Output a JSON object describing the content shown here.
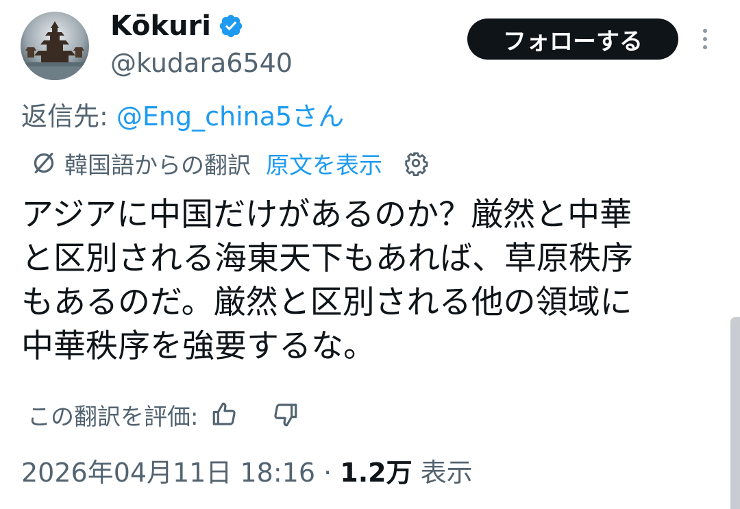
{
  "author": {
    "display_name": "Kōkuri",
    "handle": "@kudara6540",
    "verified": true,
    "avatar_icon": "avatar-pagoda-image"
  },
  "follow_button": {
    "label": "フォローする"
  },
  "more_icon": "more-vertical-icon",
  "reply": {
    "prefix": "返信先: ",
    "mention": "@Eng_china5さん"
  },
  "translation": {
    "icon": "translate-icon",
    "label": "韓国語からの翻訳",
    "show_original": "原文を表示",
    "settings_icon": "gear-icon"
  },
  "tweet": {
    "text": "アジアに中国だけがあるのか？厳然と中華\nと区別される海東天下もあれば、草原秩序\nもあるのだ。厳然と区別される他の領域に\n中華秩序を強要するな。"
  },
  "rating": {
    "label": "この翻訳を評価: ",
    "thumbs_up_icon": "thumbs-up-icon",
    "thumbs_down_icon": "thumbs-down-icon"
  },
  "meta": {
    "timestamp": "2026年04月11日 18:16",
    "separator": " · ",
    "views_count": "1.2万",
    "views_label": " 表示"
  },
  "colors": {
    "text_primary": "#0f1419",
    "text_secondary": "#536471",
    "link_blue": "#1d9bf0",
    "verified_blue": "#1d9bf0",
    "follow_bg": "#0f1419",
    "follow_text": "#ffffff"
  }
}
